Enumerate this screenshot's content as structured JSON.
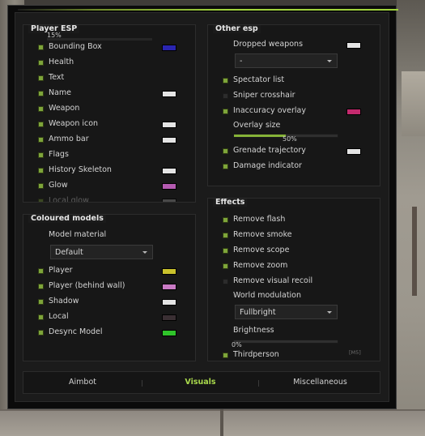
{
  "player_esp": {
    "title": "Player ESP",
    "top_value": "15%",
    "items": [
      {
        "label": "Bounding Box",
        "checked": true,
        "color": "#2a25b0"
      },
      {
        "label": "Health",
        "checked": true,
        "color": null
      },
      {
        "label": "Text",
        "checked": true,
        "color": null
      },
      {
        "label": "Name",
        "checked": true,
        "color": "#e4e4e4"
      },
      {
        "label": "Weapon",
        "checked": true,
        "color": null
      },
      {
        "label": "Weapon icon",
        "checked": true,
        "color": "#e4e4e4"
      },
      {
        "label": "Ammo bar",
        "checked": true,
        "color": "#e4e4e4"
      },
      {
        "label": "Flags",
        "checked": true,
        "color": null
      },
      {
        "label": "History Skeleton",
        "checked": true,
        "color": "#e4e4e4"
      },
      {
        "label": "Glow",
        "checked": true,
        "color": "#b45ab0"
      },
      {
        "label": "Local glow",
        "checked": true,
        "color": "#6a6a6a"
      }
    ]
  },
  "coloured_models": {
    "title": "Coloured models",
    "material_label": "Model material",
    "material_value": "Default",
    "items": [
      {
        "label": "Player",
        "checked": true,
        "color": "#c9c12c"
      },
      {
        "label": "Player (behind wall)",
        "checked": true,
        "color": "#c97ac4"
      },
      {
        "label": "Shadow",
        "checked": true,
        "color": "#e4e4e4"
      },
      {
        "label": "Local",
        "checked": true,
        "color": "#3a2f33"
      },
      {
        "label": "Desync Model",
        "checked": true,
        "color": "#2fc42a"
      }
    ]
  },
  "other_esp": {
    "title": "Other esp",
    "dropped_weapons_label": "Dropped weapons",
    "dropped_weapons_color": "#e4e4e4",
    "dropped_weapons_value": "-",
    "items": [
      {
        "label": "Spectator list",
        "checked": true,
        "color": null
      },
      {
        "label": "Sniper crosshair",
        "checked": false,
        "color": null
      },
      {
        "label": "Inaccuracy overlay",
        "checked": true,
        "color": "#c42a6e"
      }
    ],
    "overlay_size_label": "Overlay size",
    "overlay_size_value": "50%",
    "overlay_size_fraction": 0.5,
    "items2": [
      {
        "label": "Grenade trajectory",
        "checked": true,
        "color": "#e4e4e4"
      },
      {
        "label": "Damage indicator",
        "checked": true,
        "color": null
      }
    ]
  },
  "effects": {
    "title": "Effects",
    "items": [
      {
        "label": "Remove flash",
        "checked": true
      },
      {
        "label": "Remove smoke",
        "checked": true
      },
      {
        "label": "Remove scope",
        "checked": true
      },
      {
        "label": "Remove zoom",
        "checked": true
      },
      {
        "label": "Remove visual recoil",
        "checked": false
      }
    ],
    "world_modulation_label": "World modulation",
    "world_modulation_value": "Fullbright",
    "brightness_label": "Brightness",
    "brightness_value": "0%",
    "brightness_fraction": 0,
    "thirdperson_label": "Thirdperson",
    "thirdperson_checked": true,
    "thirdperson_key": "[M5]"
  },
  "tabs": [
    {
      "label": "Aimbot",
      "active": false
    },
    {
      "label": "Visuals",
      "active": true
    },
    {
      "label": "Miscellaneous",
      "active": false
    }
  ],
  "colors": {
    "accent": "#9fd23b",
    "checkbox_on": "#7ea53a",
    "checkbox_off": "#2c2c2c"
  }
}
